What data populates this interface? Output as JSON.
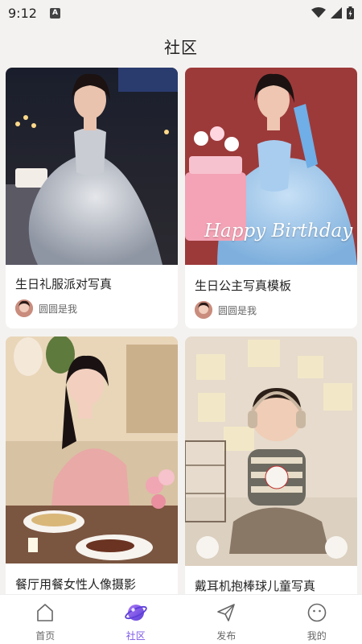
{
  "status": {
    "time": "9:12"
  },
  "header": {
    "title": "社区"
  },
  "posts": [
    {
      "title": "生日礼服派对写真",
      "author": "圆圆是我"
    },
    {
      "title": "生日公主写真模板",
      "author": "圆圆是我",
      "overlay_text": "Happy Birthday"
    },
    {
      "title": "餐厅用餐女性人像摄影"
    },
    {
      "title": "戴耳机抱棒球儿童写真"
    }
  ],
  "nav": {
    "items": [
      {
        "label": "首页",
        "icon": "home-icon"
      },
      {
        "label": "社区",
        "icon": "community-planet-icon",
        "active": true
      },
      {
        "label": "发布",
        "icon": "send-icon"
      },
      {
        "label": "我的",
        "icon": "profile-face-icon"
      }
    ],
    "active_color": "#7b55e6"
  }
}
